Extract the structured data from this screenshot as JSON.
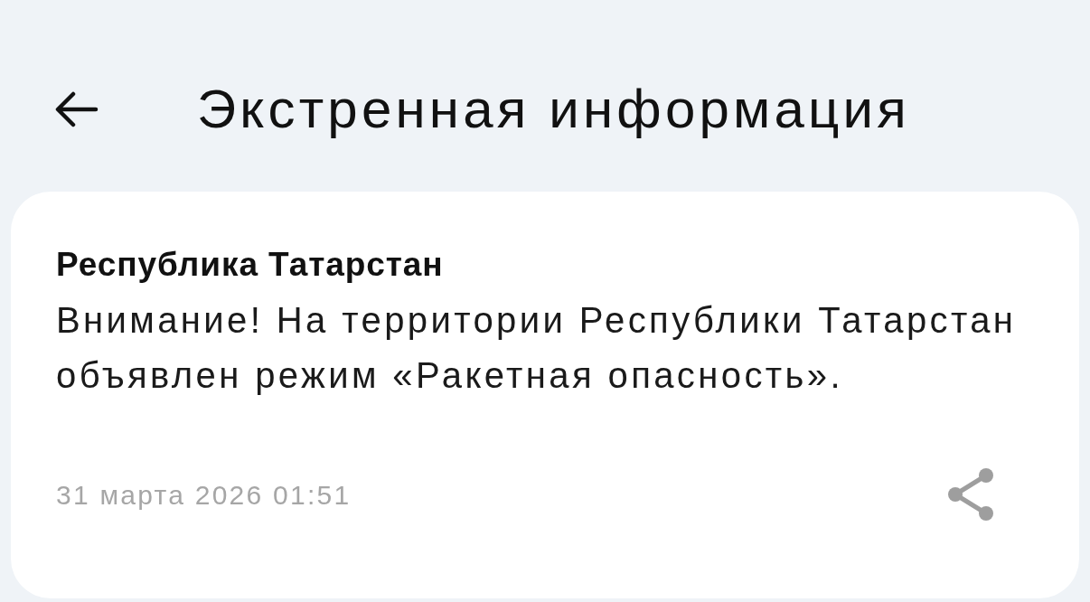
{
  "header": {
    "title": "Экстренная информация"
  },
  "alert": {
    "region": "Республика Татарстан",
    "message": "Внимание! На территории Республики Татарстан объявлен режим «Ракетная опасность».",
    "date": "31 марта 2026 01:51"
  }
}
